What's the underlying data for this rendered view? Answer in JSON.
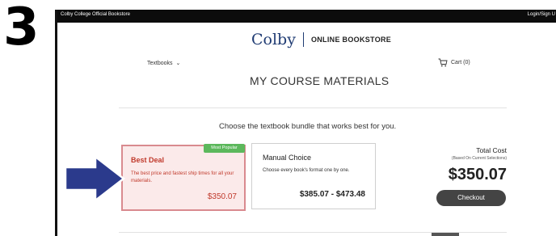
{
  "step_number": "3",
  "topbar": {
    "left_text": "Colby College Official Bookstore",
    "right_text": "Login/Sign U"
  },
  "brand": {
    "logo": "Colby",
    "store_name": "ONLINE BOOKSTORE"
  },
  "nav": {
    "textbooks_label": "Textbooks",
    "cart_label": "Cart (0)"
  },
  "page_title": "MY COURSE MATERIALS",
  "instruction": "Choose the textbook bundle that works best for you.",
  "best_deal": {
    "badge": "Most Popular",
    "title": "Best Deal",
    "description": "The best price and fastest ship times for all your materials.",
    "price": "$350.07"
  },
  "manual_choice": {
    "title": "Manual Choice",
    "description": "Choose every book's format one by one.",
    "price": "$385.07 - $473.48"
  },
  "total": {
    "label": "Total Cost",
    "sub": "(Based On Current Selections)",
    "price": "$350.07",
    "checkout_label": "Checkout"
  },
  "colors": {
    "arrow": "#2b3a8c",
    "accent_red": "#c0392b",
    "badge_green": "#5cb85c",
    "brand_blue": "#1f3b73"
  }
}
